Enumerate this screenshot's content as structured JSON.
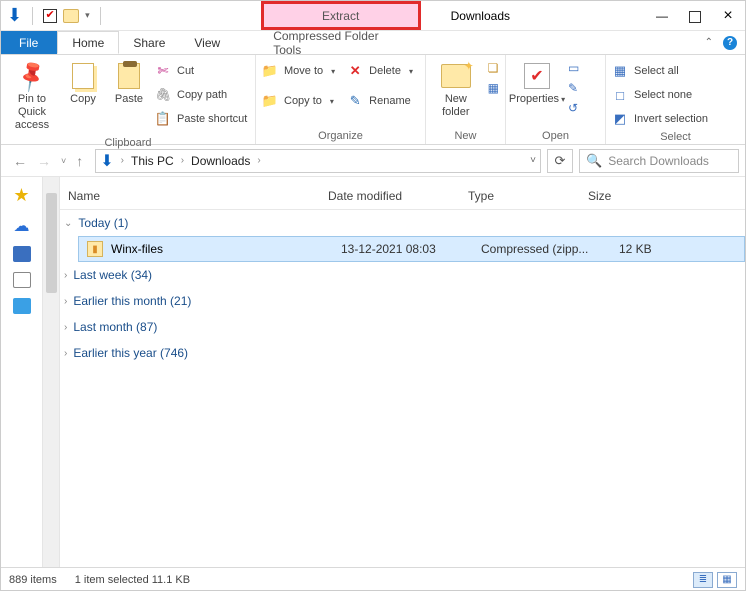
{
  "titlebar": {
    "contextual_tab_header": "Extract",
    "app_title": "Downloads"
  },
  "tabs": {
    "file": "File",
    "home": "Home",
    "share": "Share",
    "view": "View",
    "context_tool": "Compressed Folder Tools"
  },
  "ribbon": {
    "clipboard": {
      "label": "Clipboard",
      "pin": "Pin to Quick access",
      "copy": "Copy",
      "paste": "Paste",
      "cut": "Cut",
      "copy_path": "Copy path",
      "paste_shortcut": "Paste shortcut"
    },
    "organize": {
      "label": "Organize",
      "move_to": "Move to",
      "copy_to": "Copy to",
      "delete": "Delete",
      "rename": "Rename"
    },
    "new": {
      "label": "New",
      "new_folder": "New folder"
    },
    "open": {
      "label": "Open",
      "properties": "Properties"
    },
    "select": {
      "label": "Select",
      "select_all": "Select all",
      "select_none": "Select none",
      "invert": "Invert selection"
    }
  },
  "address": {
    "this_pc": "This PC",
    "downloads": "Downloads"
  },
  "search": {
    "placeholder": "Search Downloads"
  },
  "columns": {
    "name": "Name",
    "date": "Date modified",
    "type": "Type",
    "size": "Size"
  },
  "groups": {
    "today": "Today (1)",
    "last_week": "Last week (34)",
    "this_month": "Earlier this month (21)",
    "last_month": "Last month (87)",
    "this_year": "Earlier this year (746)"
  },
  "file": {
    "name": "Winx-files",
    "date": "13-12-2021 08:03",
    "type": "Compressed (zipp...",
    "size": "12 KB"
  },
  "status": {
    "items": "889 items",
    "selected": "1 item selected  11.1 KB"
  }
}
